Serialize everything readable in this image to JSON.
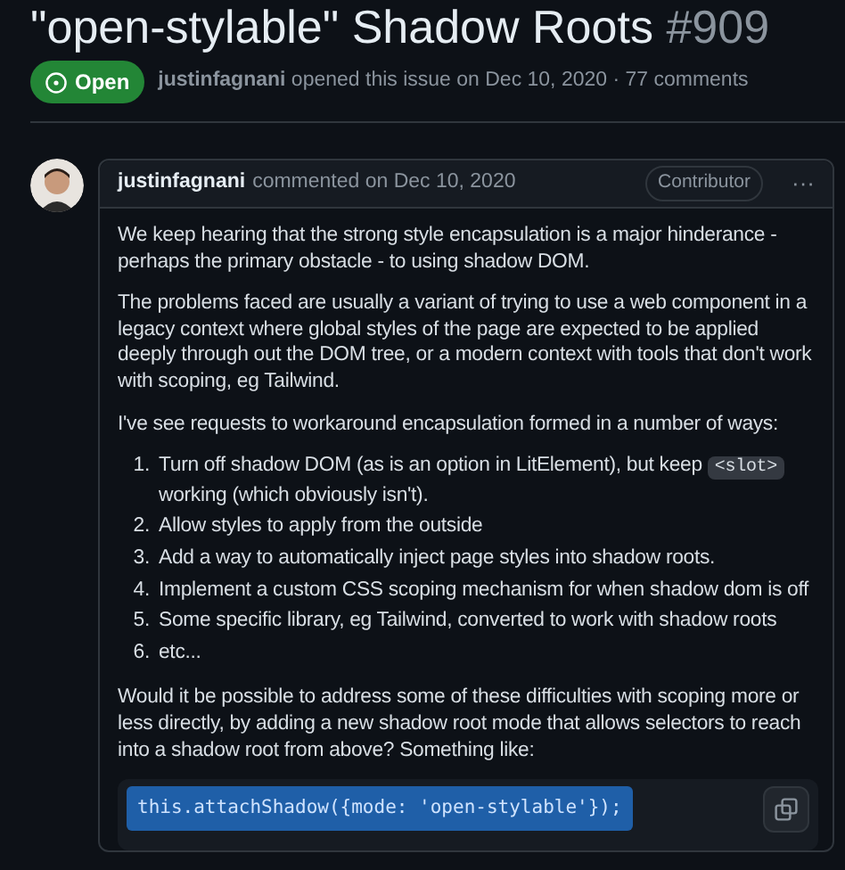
{
  "issue": {
    "title": "\"open-stylable\" Shadow Roots",
    "number": "#909",
    "status": "Open",
    "author": "justinfagnani",
    "meta": "opened this issue on Dec 10, 2020 · 77 comments"
  },
  "comment": {
    "author": "justinfagnani",
    "meta": "commented on Dec 10, 2020",
    "role": "Contributor",
    "menu": "···",
    "paragraphs_before": [
      "We keep hearing that the strong style encapsulation is a major hinderance - perhaps the primary obstacle - to using shadow DOM.",
      "The problems faced are usually a variant of trying to use a web component in a legacy context where global styles of the page are expected to be applied deeply through out the DOM tree, or a modern context with tools that don't work with scoping, eg Tailwind.",
      "I've see requests to workaround encapsulation formed in a number of ways:"
    ],
    "list": [
      {
        "number": "1.",
        "text": "Turn off shadow DOM (as is an option in LitElement), but keep",
        "code": "<slot>",
        "text_after": "working (which obviously isn't)."
      },
      {
        "number": "2.",
        "text": "Allow styles to apply from the outside"
      },
      {
        "number": "3.",
        "text": "Add a way to automatically inject page styles into shadow roots."
      },
      {
        "number": "4.",
        "text": "Implement a custom CSS scoping mechanism for when shadow dom is off"
      },
      {
        "number": "5.",
        "text": "Some specific library, eg Tailwind, converted to work with shadow roots"
      },
      {
        "number": "6.",
        "text": "etc..."
      }
    ],
    "paragraphs_after": [
      "Would it be possible to address some of these difficulties with scoping more or less directly, by adding a new shadow root mode that allows selectors to reach into a shadow root from above? Something like:"
    ],
    "code_block": {
      "code": "this.attachShadow({mode: 'open-stylable'});",
      "selected": true
    }
  }
}
